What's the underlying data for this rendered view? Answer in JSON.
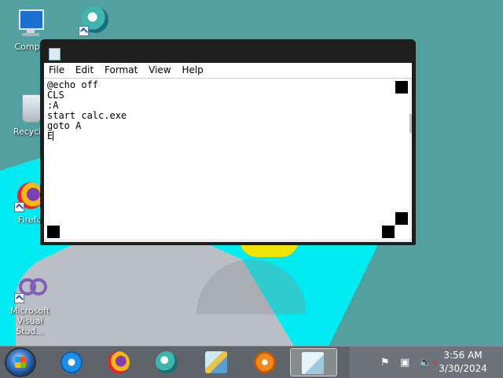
{
  "desktop": {
    "icons": [
      {
        "label": "Compu"
      },
      {
        "label": ""
      },
      {
        "label": "Recycle"
      },
      {
        "label": "Firefo"
      },
      {
        "label": "Microsoft"
      },
      {
        "label": "Visual Stud..."
      }
    ]
  },
  "notepad": {
    "title": "",
    "menu": [
      "File",
      "Edit",
      "Format",
      "View",
      "Help"
    ],
    "content": "@echo off\nCLS\n:A\nstart calc.exe\ngoto A\nE"
  },
  "taskbar": {
    "pinned": [
      {
        "icon": "internet-explorer-icon"
      },
      {
        "icon": "firefox-icon"
      },
      {
        "icon": "app-circle-icon"
      },
      {
        "icon": "control-panel-icon"
      },
      {
        "icon": "media-player-icon"
      },
      {
        "icon": "notepad-icon",
        "active": true
      }
    ],
    "tray_icons": [
      "flag-icon",
      "network-icon",
      "volume-muted-icon"
    ],
    "clock": {
      "time": "3:56 AM",
      "date": "3/30/2024"
    }
  },
  "colors": {
    "wallpaper": "#52a0a0",
    "accent_cyan": "#00ecf2",
    "taskbar": "#5e6469"
  }
}
